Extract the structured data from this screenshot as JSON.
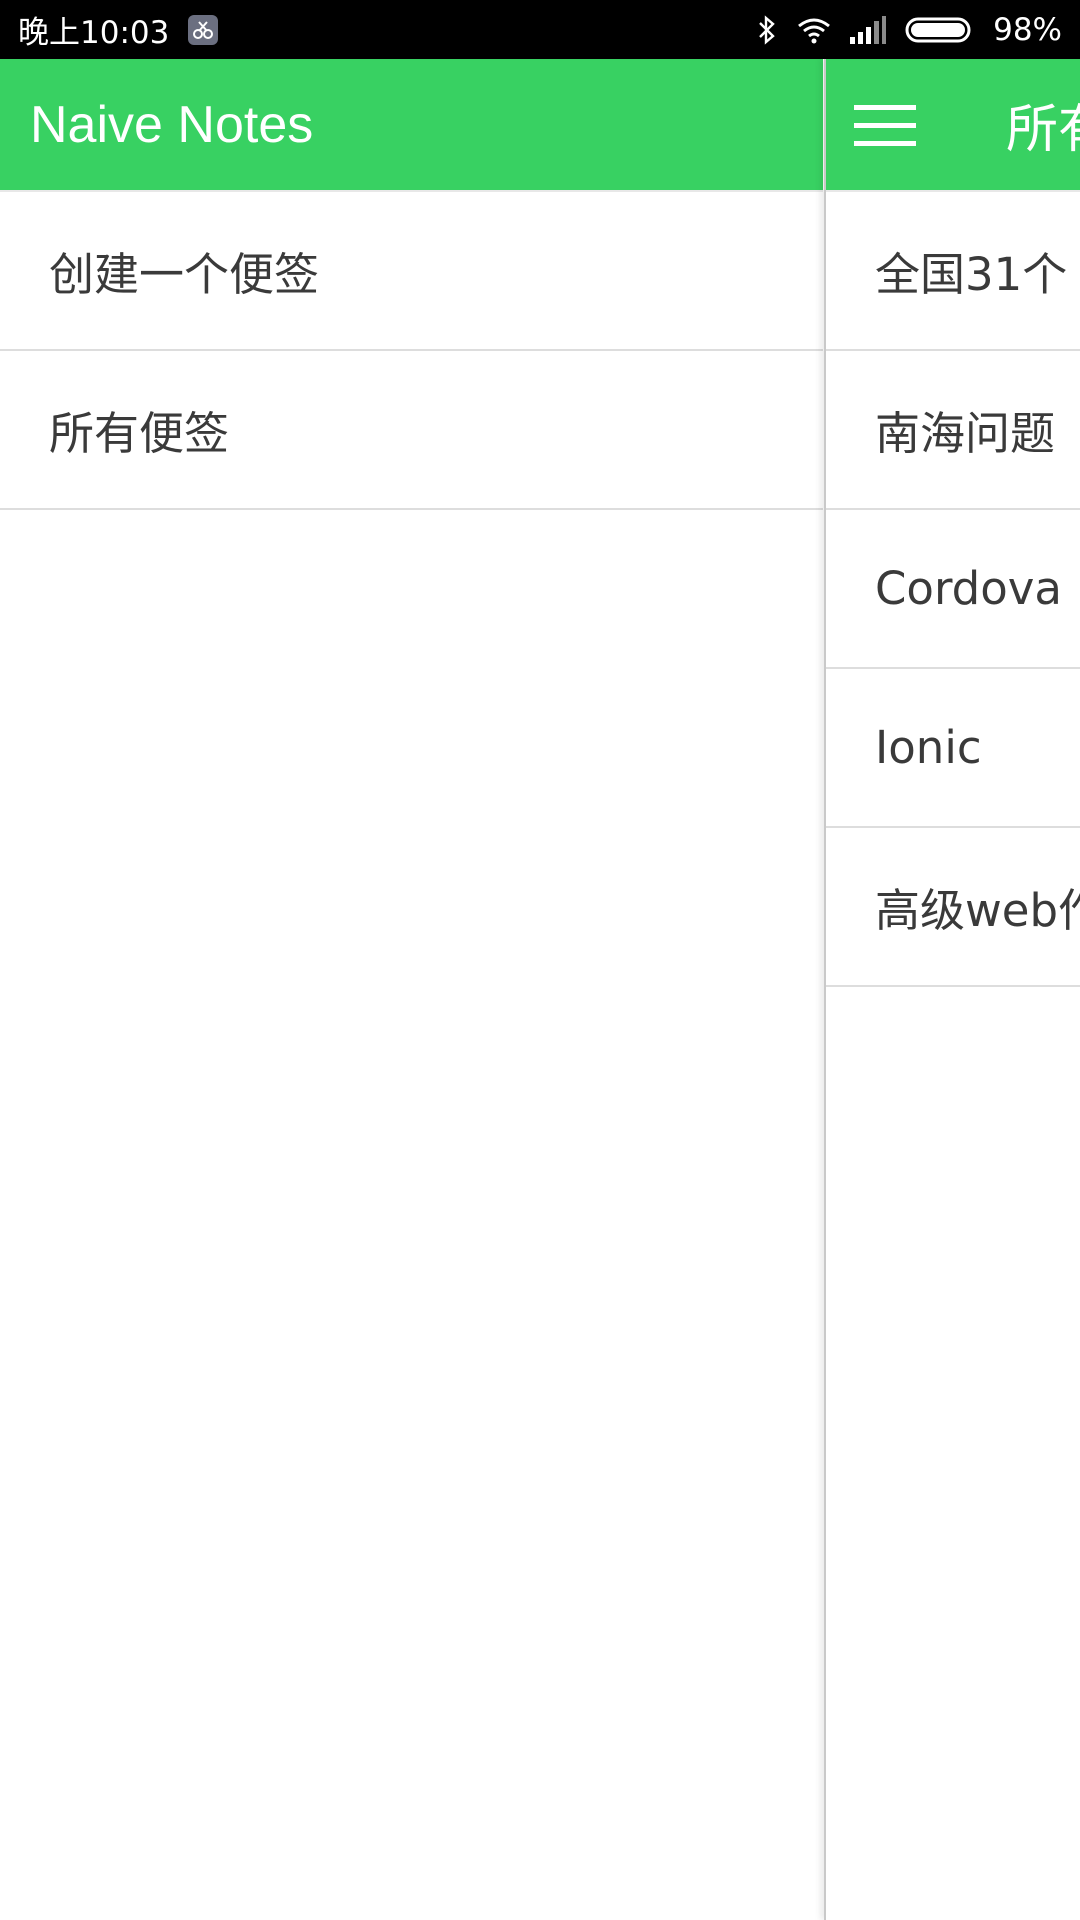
{
  "status_bar": {
    "time": "晚上10:03",
    "battery": "98%",
    "icons": [
      "notification-app-icon",
      "bluetooth-icon",
      "wifi-icon",
      "signal-icon",
      "battery-icon"
    ]
  },
  "drawer": {
    "title": "Naive Notes",
    "items": [
      {
        "label": "创建一个便签"
      },
      {
        "label": "所有便签"
      }
    ]
  },
  "main": {
    "title": "所有",
    "notes": [
      {
        "title": "全国31个"
      },
      {
        "title": "南海问题"
      },
      {
        "title": "Cordova"
      },
      {
        "title": "Ionic"
      },
      {
        "title": "高级web作"
      }
    ]
  },
  "colors": {
    "accent": "#38d162",
    "status_bar": "#000000",
    "text": "#3a3a3a",
    "divider": "#dddddd"
  }
}
